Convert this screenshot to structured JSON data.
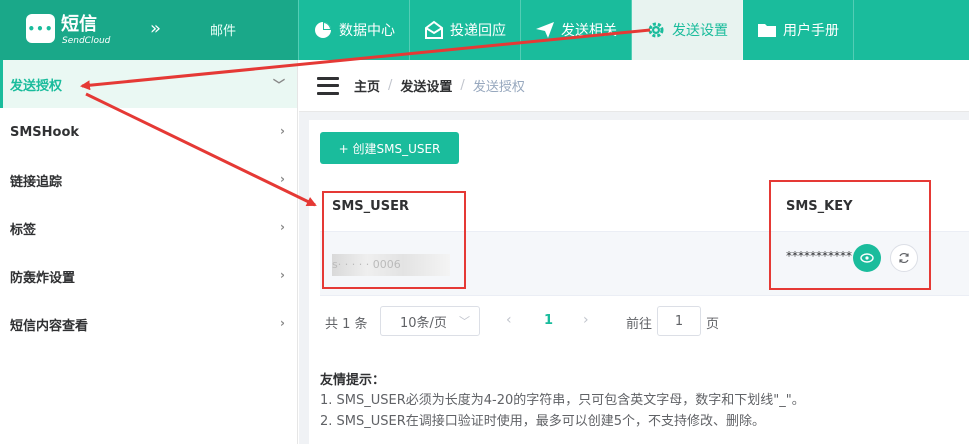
{
  "brand": {
    "name": "短信",
    "sub": "SendCloud"
  },
  "header": {
    "collapse_icon": "double-chevron-right-icon",
    "mail_link": "邮件",
    "nav": [
      {
        "label": "数据中心",
        "icon": "pie-chart-icon"
      },
      {
        "label": "投递回应",
        "icon": "mail-open-icon"
      },
      {
        "label": "发送相关",
        "icon": "send-icon"
      },
      {
        "label": "发送设置",
        "icon": "gear-icon",
        "active": true
      },
      {
        "label": "用户手册",
        "icon": "folder-icon"
      }
    ]
  },
  "sidebar": {
    "items": [
      {
        "label": "发送授权",
        "active": true
      },
      {
        "label": "SMSHook"
      },
      {
        "label": "链接追踪"
      },
      {
        "label": "标签"
      },
      {
        "label": "防轰炸设置"
      },
      {
        "label": "短信内容查看"
      }
    ]
  },
  "breadcrumb": {
    "home": "主页",
    "section": "发送设置",
    "current": "发送授权",
    "separator": "/"
  },
  "main": {
    "create_button": "+ 创建SMS_USER",
    "table": {
      "columns": [
        "SMS_USER",
        "SMS_KEY"
      ],
      "rows": [
        {
          "sms_user": "s·  ·  ·  ·  · 0006",
          "sms_key": "***********"
        }
      ]
    },
    "pagination": {
      "total": "共 1 条",
      "page_size": "10条/页",
      "current_page": "1",
      "goto_label": "前往",
      "goto_value": "1",
      "page_suffix": "页"
    },
    "tips": {
      "title": "友情提示：",
      "items": [
        "1. SMS_USER必须为长度为4-20的字符串，只可包含英文字母，数字和下划线\"_\"。",
        "2. SMS_USER在调接口验证时使用，最多可以创建5个，不支持修改、删除。"
      ]
    }
  },
  "colors": {
    "accent": "#1abc9c",
    "header_dark": "#1aa889",
    "annotation_red": "#e53935"
  }
}
